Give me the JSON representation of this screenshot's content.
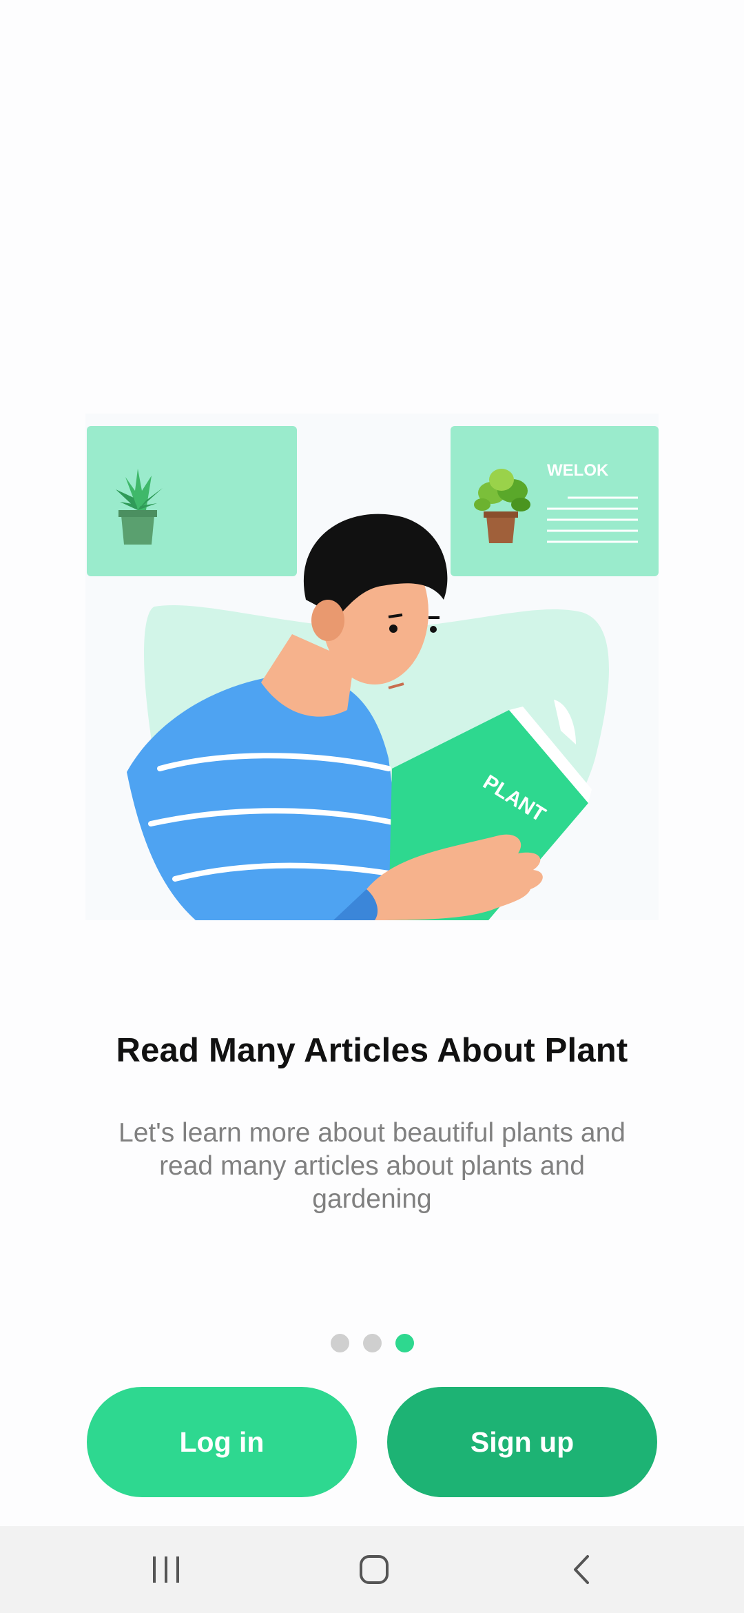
{
  "onboarding": {
    "title": "Read Many Articles About Plant",
    "description": "Let's learn more about beautiful plants and read many articles about plants and gardening",
    "page_indicator": {
      "total": 3,
      "current": 3
    },
    "illustration": {
      "card_heading": "WELOK",
      "book_title": "PLANT"
    }
  },
  "actions": {
    "login_label": "Log in",
    "signup_label": "Sign up"
  },
  "navigation_bar": {
    "icons": [
      "recent-apps-icon",
      "home-icon",
      "back-icon"
    ]
  },
  "colors": {
    "accent": "#2ed890",
    "accent_dark": "#1db374",
    "card": "#9aebcc",
    "shirt": "#4ea3f2",
    "dot_inactive": "#cfcfcf"
  }
}
